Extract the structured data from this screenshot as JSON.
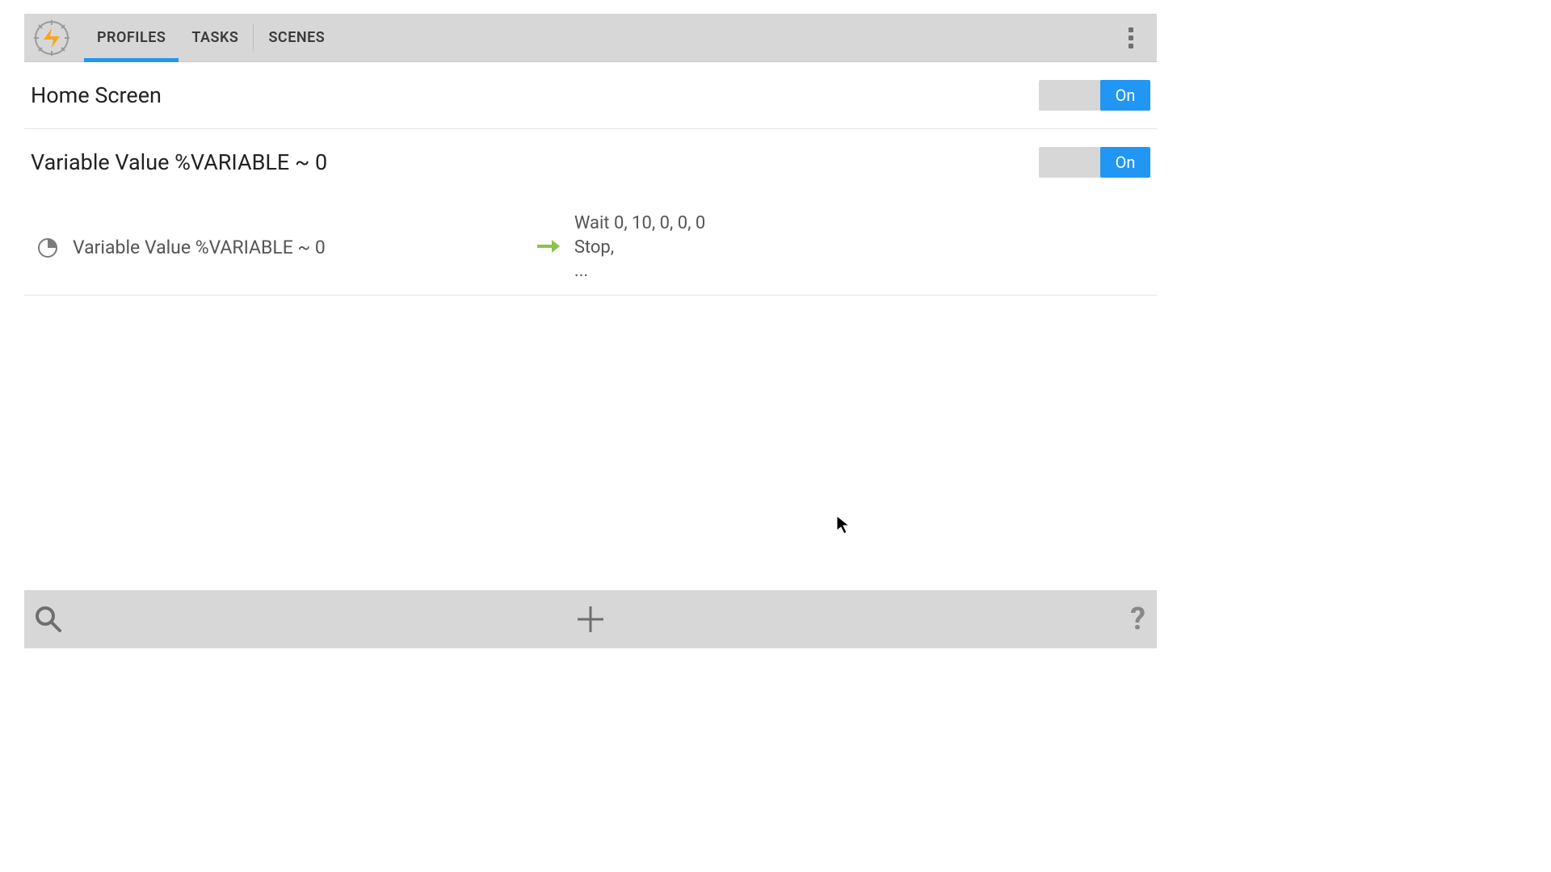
{
  "tabs": {
    "profiles": "PROFILES",
    "tasks": "TASKS",
    "scenes": "SCENES"
  },
  "profiles": [
    {
      "title": "Home Screen",
      "toggle": "On"
    },
    {
      "title": "Variable Value %VARIABLE ~ 0",
      "toggle": "On",
      "context_label": "Variable Value %VARIABLE ~ 0",
      "task_line1": "Wait 0, 10, 0, 0, 0",
      "task_line2": "Stop,",
      "task_line3": "..."
    }
  ],
  "bottom": {
    "help": "?"
  }
}
